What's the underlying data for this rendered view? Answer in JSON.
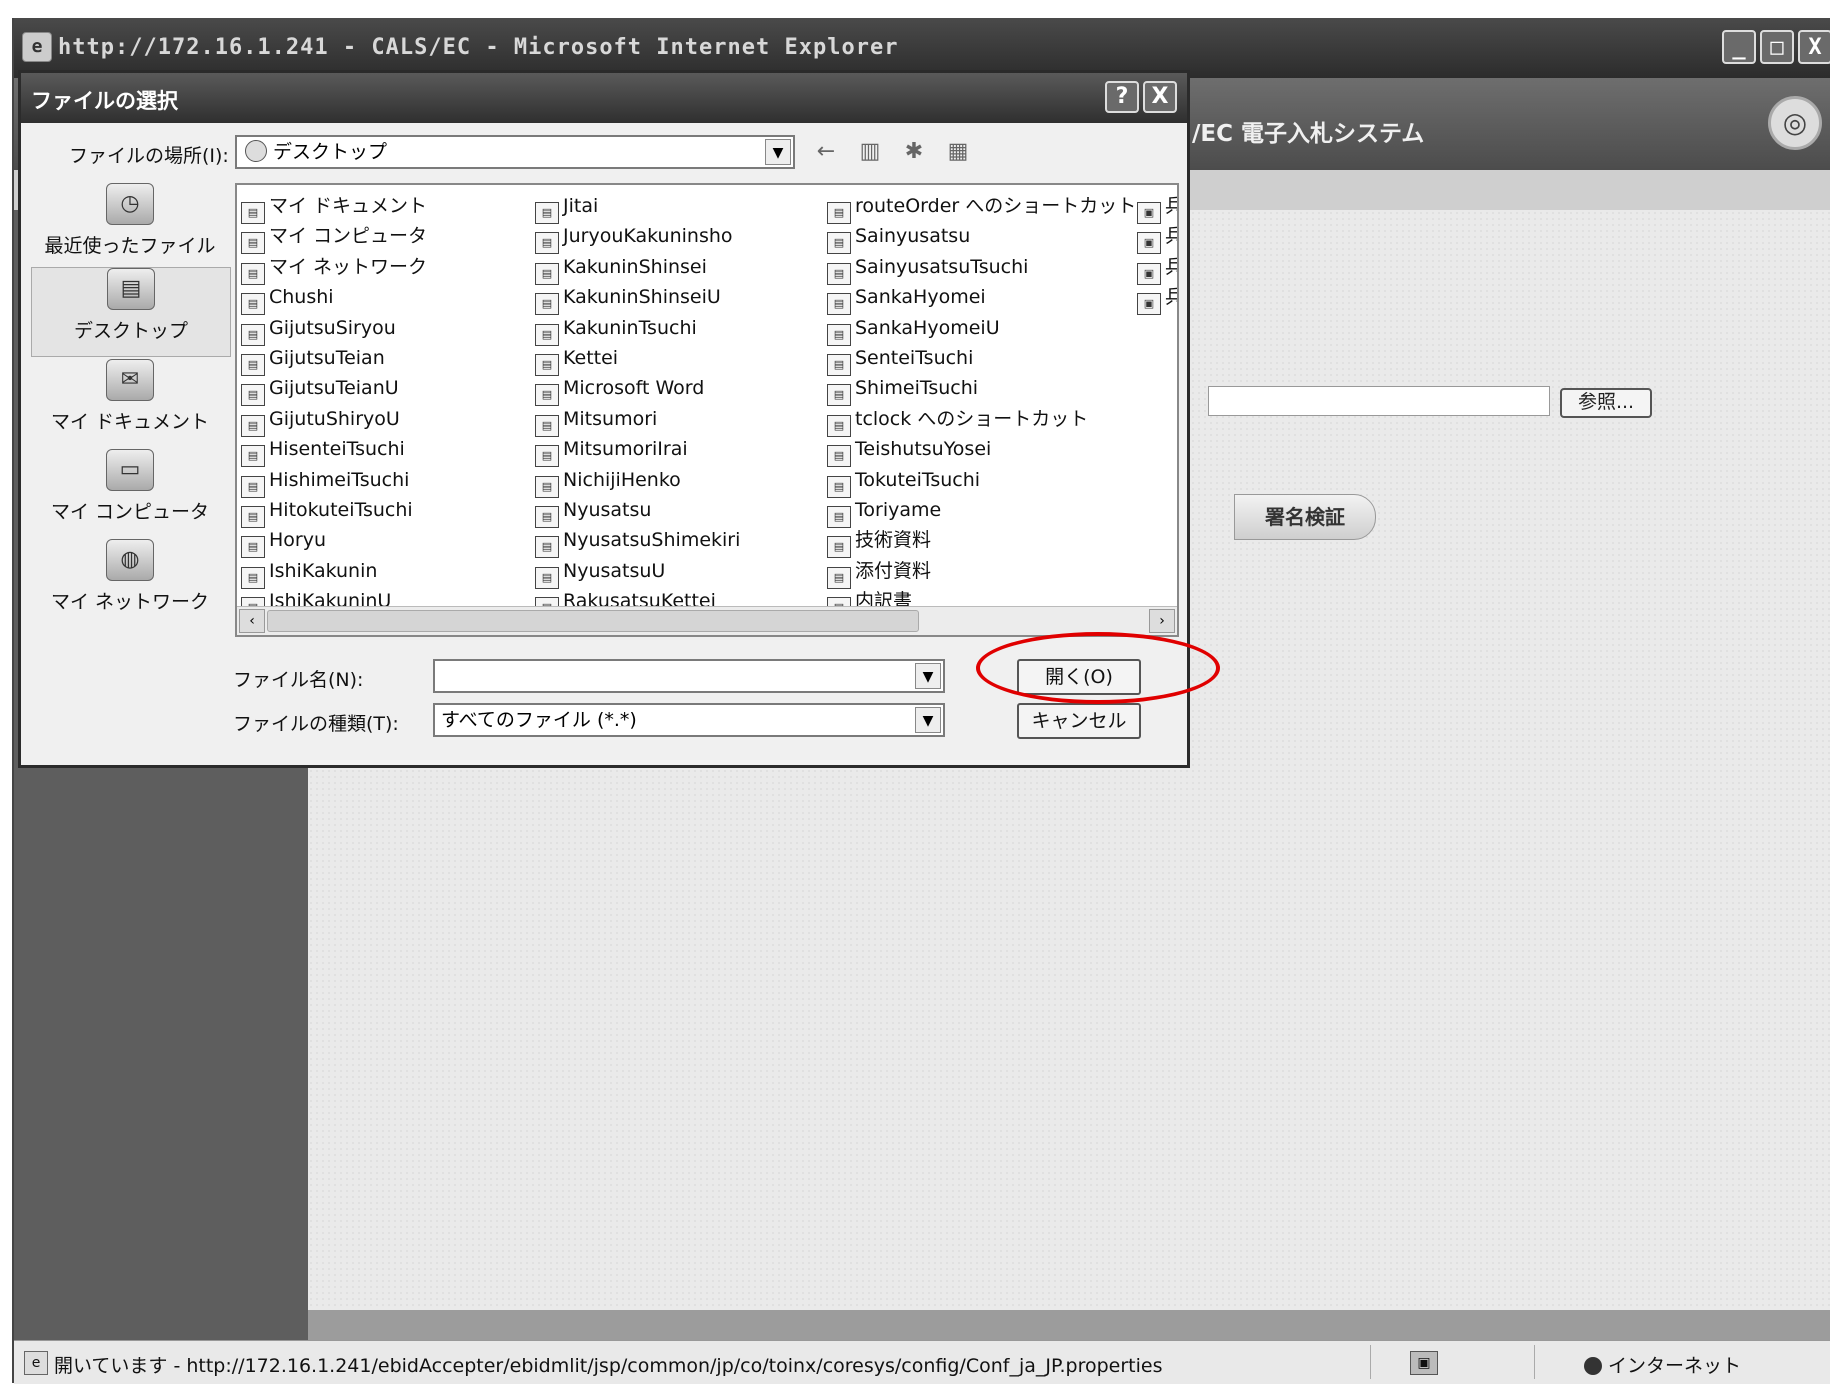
{
  "ie_window": {
    "title": "http://172.16.1.241 - CALS/EC - Microsoft Internet Explorer",
    "buttons": [
      "_",
      "□",
      "X"
    ]
  },
  "app": {
    "system_title": "/EC 電子入札システム",
    "browse_button": "参照...",
    "sign_verify_button": "署名検証"
  },
  "statusbar": {
    "text": "開いています - http://172.16.1.241/ebidAccepter/ebidmlit/jsp/common/jp/co/toinx/coresys/config/Conf_ja_JP.properties",
    "zone": "インターネット"
  },
  "dialog": {
    "title": "ファイルの選択",
    "help_button": "?",
    "close_button": "X",
    "lookin_label": "ファイルの場所(I):",
    "lookin_value": "デスクトップ",
    "places": [
      {
        "label": "最近使ったファイル",
        "icon": "recent-icon"
      },
      {
        "label": "デスクトップ",
        "icon": "desktop-icon"
      },
      {
        "label": "マイ ドキュメント",
        "icon": "documents-icon"
      },
      {
        "label": "マイ コンピュータ",
        "icon": "computer-icon"
      },
      {
        "label": "マイ ネットワーク",
        "icon": "network-icon"
      }
    ],
    "files": {
      "col1": [
        "マイ ドキュメント",
        "マイ コンピュータ",
        "マイ ネットワーク",
        "Chushi",
        "GijutsuSiryou",
        "GijutsuTeian",
        "GijutsuTeianU",
        "GijutuShiryoU",
        "HisenteiTsuchi",
        "HishimeiTsuchi",
        "HitokuteiTsuchi",
        "Horyu",
        "IshiKakunin",
        "IshiKakuninU"
      ],
      "col2": [
        "Jitai",
        "JuryouKakuninsho",
        "KakuninShinsei",
        "KakuninShinseiU",
        "KakuninTsuchi",
        "Kettei",
        "Microsoft Word",
        "Mitsumori",
        "MitsumoriIrai",
        "NichijiHenko",
        "Nyusatsu",
        "NyusatsuShimekiri",
        "NyusatsuU",
        "RakusatsuKettei"
      ],
      "col3": [
        "routeOrder へのショートカット",
        "Sainyusatsu",
        "SainyusatsuTsuchi",
        "SankaHyomei",
        "SankaHyomeiU",
        "SenteiTsuchi",
        "ShimeiTsuchi",
        "tclock へのショートカット",
        "TeishutsuYosei",
        "TokuteiTsuchi",
        "Toriyame",
        "技術資料",
        "添付資料",
        "内訳書"
      ],
      "col4": [
        "兵",
        "兵",
        "兵",
        "兵"
      ]
    },
    "filename_label": "ファイル名(N):",
    "filename_value": "",
    "filetype_label": "ファイルの種類(T):",
    "filetype_value": "すべてのファイル (*.*)",
    "open_button": "開く(O)",
    "cancel_button": "キャンセル"
  },
  "colors": {
    "highlight": "#e00000",
    "title_bar": "#2f2f2f"
  }
}
